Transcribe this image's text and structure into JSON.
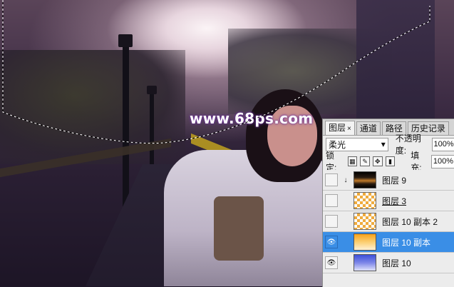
{
  "watermark": "www.68ps.com",
  "panel": {
    "tabs": [
      {
        "label": "图层",
        "active": true
      },
      {
        "label": "通道",
        "active": false
      },
      {
        "label": "路径",
        "active": false
      },
      {
        "label": "历史记录",
        "active": false
      }
    ],
    "tab_close": "×",
    "blend_mode": "柔光",
    "opacity_label": "不透明度:",
    "opacity_value": "100%",
    "lock_label": "锁定:",
    "fill_label": "填充:",
    "fill_value": "100%",
    "layers": [
      {
        "name": "图层 9",
        "visible": false,
        "thumb": "sunset",
        "clipped": true,
        "selected": false
      },
      {
        "name": "图层 3",
        "visible": false,
        "thumb": "checker",
        "clipped": false,
        "selected": false
      },
      {
        "name": "图层 10 副本 2",
        "visible": false,
        "thumb": "checker",
        "clipped": false,
        "selected": false
      },
      {
        "name": "图层 10 副本",
        "visible": true,
        "thumb": "orange",
        "clipped": false,
        "selected": true
      },
      {
        "name": "图层 10",
        "visible": true,
        "thumb": "blue",
        "clipped": false,
        "selected": false
      }
    ]
  },
  "colors": {
    "selected_row": "#3a8ee6",
    "watermark_glow": "#6b2f9a"
  }
}
